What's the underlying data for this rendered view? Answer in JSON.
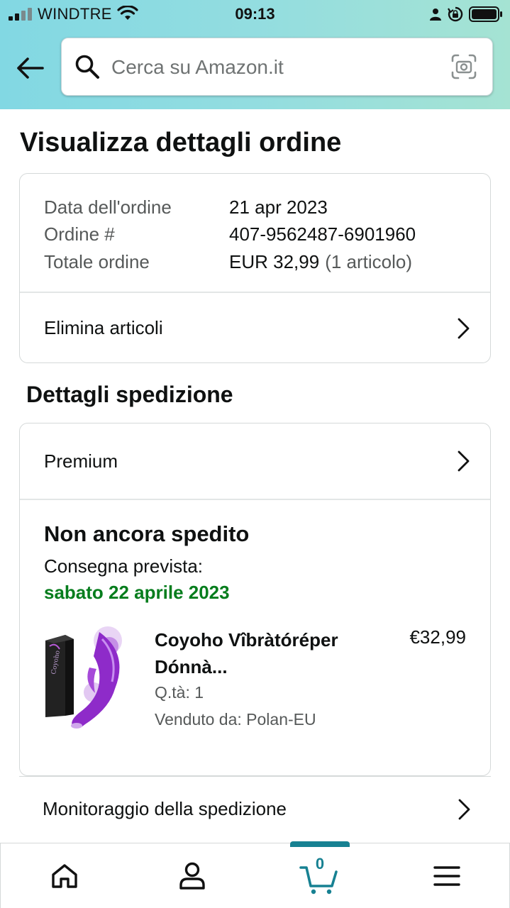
{
  "status_bar": {
    "carrier": "WINDTRE",
    "time": "09:13"
  },
  "search": {
    "placeholder": "Cerca su Amazon.it"
  },
  "page": {
    "title": "Visualizza dettagli ordine"
  },
  "order_summary": {
    "rows": [
      {
        "label": "Data dell'ordine",
        "value": "21 apr 2023",
        "extra": ""
      },
      {
        "label": "Ordine #",
        "value": "407-9562487-6901960",
        "extra": ""
      },
      {
        "label": "Totale ordine",
        "value": "EUR 32,99",
        "extra": "(1 articolo)"
      }
    ],
    "action_label": "Elimina articoli"
  },
  "shipping": {
    "section_title": "Dettagli spedizione",
    "method_label": "Premium",
    "status": "Non ancora spedito",
    "delivery_label": "Consegna prevista:",
    "delivery_date": "sabato 22 aprile 2023",
    "item": {
      "title_line1": "Coyoho Vîbràtóréper",
      "title_line2": "Dónnà...",
      "price": "€32,99",
      "quantity": "Q.tà: 1",
      "seller": "Venduto da: Polan-EU"
    },
    "tracking_label": "Monitoraggio della spedizione"
  },
  "bottom_nav": {
    "cart_count": "0",
    "items": [
      "home-icon",
      "account-icon",
      "cart-icon",
      "menu-icon"
    ],
    "active": "cart-icon"
  },
  "colors": {
    "header_gradient_start": "#82d8e3",
    "header_gradient_end": "#a5e3d3",
    "delivery_green": "#067d1d",
    "accent_teal": "#178192",
    "muted_text": "#565959"
  }
}
